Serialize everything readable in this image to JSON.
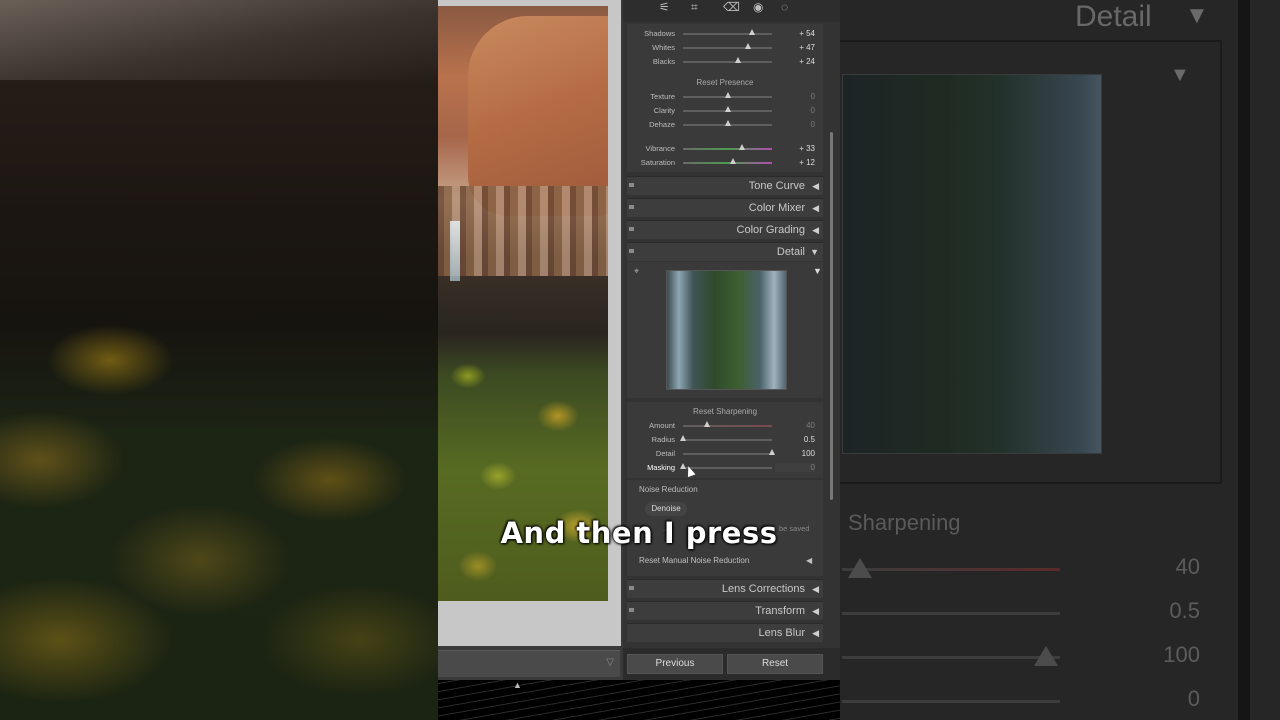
{
  "caption": "And then I press",
  "background_right": {
    "title": "Detail",
    "section_label": "Sharpening",
    "values": [
      "40",
      "0.5",
      "100",
      "0"
    ]
  },
  "presence": {
    "tone_rows": [
      {
        "label": "Shadows",
        "value": "+ 54",
        "level": 0.77
      },
      {
        "label": "Whites",
        "value": "+ 47",
        "level": 0.73
      },
      {
        "label": "Blacks",
        "value": "+ 24",
        "level": 0.62
      }
    ],
    "reset_label": "Reset Presence",
    "rows": [
      {
        "label": "Texture",
        "value": "0",
        "level": 0.5
      },
      {
        "label": "Clarity",
        "value": "0",
        "level": 0.5
      },
      {
        "label": "Dehaze",
        "value": "0",
        "level": 0.5
      }
    ],
    "color_rows": [
      {
        "label": "Vibrance",
        "value": "+ 33",
        "level": 0.66
      },
      {
        "label": "Saturation",
        "value": "+ 12",
        "level": 0.56
      }
    ]
  },
  "sections": [
    "Tone Curve",
    "Color Mixer",
    "Color Grading",
    "Detail"
  ],
  "sharpening": {
    "reset_label": "Reset Sharpening",
    "rows": [
      {
        "label": "Amount",
        "value": "40",
        "level": 0.27
      },
      {
        "label": "Radius",
        "value": "0.5",
        "level": 0.0
      },
      {
        "label": "Detail",
        "value": "100",
        "level": 1.0
      },
      {
        "label": "Masking",
        "value": "0",
        "level": 0.0
      }
    ]
  },
  "noise": {
    "label": "Noise Reduction",
    "denoise_button": "Denoise",
    "partial_text_1": "...",
    "partial_text_2": "be saved",
    "reset_label": "Reset Manual Noise Reduction"
  },
  "lower_sections": [
    "Lens Corrections",
    "Transform",
    "Lens Blur"
  ],
  "buttons": {
    "previous": "Previous",
    "reset": "Reset"
  }
}
